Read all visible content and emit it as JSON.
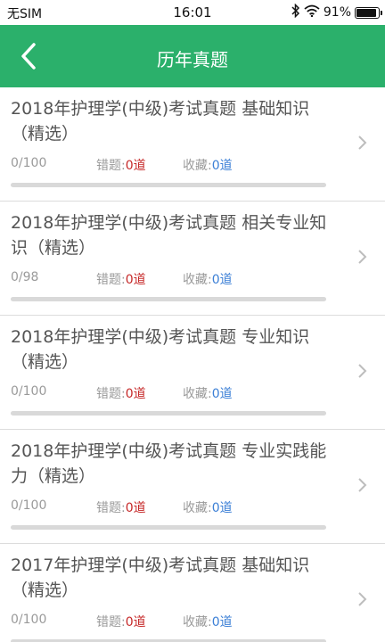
{
  "status_bar": {
    "carrier": "无SIM",
    "time": "16:01",
    "battery": "91%",
    "battery_level": 0.91,
    "icons": [
      "bluetooth-icon",
      "wifi-icon",
      "battery-icon"
    ]
  },
  "header": {
    "title": "历年真题",
    "back_icon": "chevron-left-icon",
    "color": "#2bb06b"
  },
  "labels": {
    "wrong": "错题:",
    "favorite": "收藏:"
  },
  "items": [
    {
      "title": "2018年护理学(中级)考试真题 基础知识（精选）",
      "progress": "0/100",
      "progress_ratio": 0,
      "wrong": "0道",
      "favorite": "0道"
    },
    {
      "title": "2018年护理学(中级)考试真题 相关专业知识（精选）",
      "progress": "0/98",
      "progress_ratio": 0,
      "wrong": "0道",
      "favorite": "0道"
    },
    {
      "title": "2018年护理学(中级)考试真题 专业知识（精选）",
      "progress": "0/100",
      "progress_ratio": 0,
      "wrong": "0道",
      "favorite": "0道"
    },
    {
      "title": "2018年护理学(中级)考试真题 专业实践能力（精选）",
      "progress": "0/100",
      "progress_ratio": 0,
      "wrong": "0道",
      "favorite": "0道"
    },
    {
      "title": "2017年护理学(中级)考试真题 基础知识（精选）",
      "progress": "0/100",
      "progress_ratio": 0,
      "wrong": "0道",
      "favorite": "0道"
    }
  ]
}
